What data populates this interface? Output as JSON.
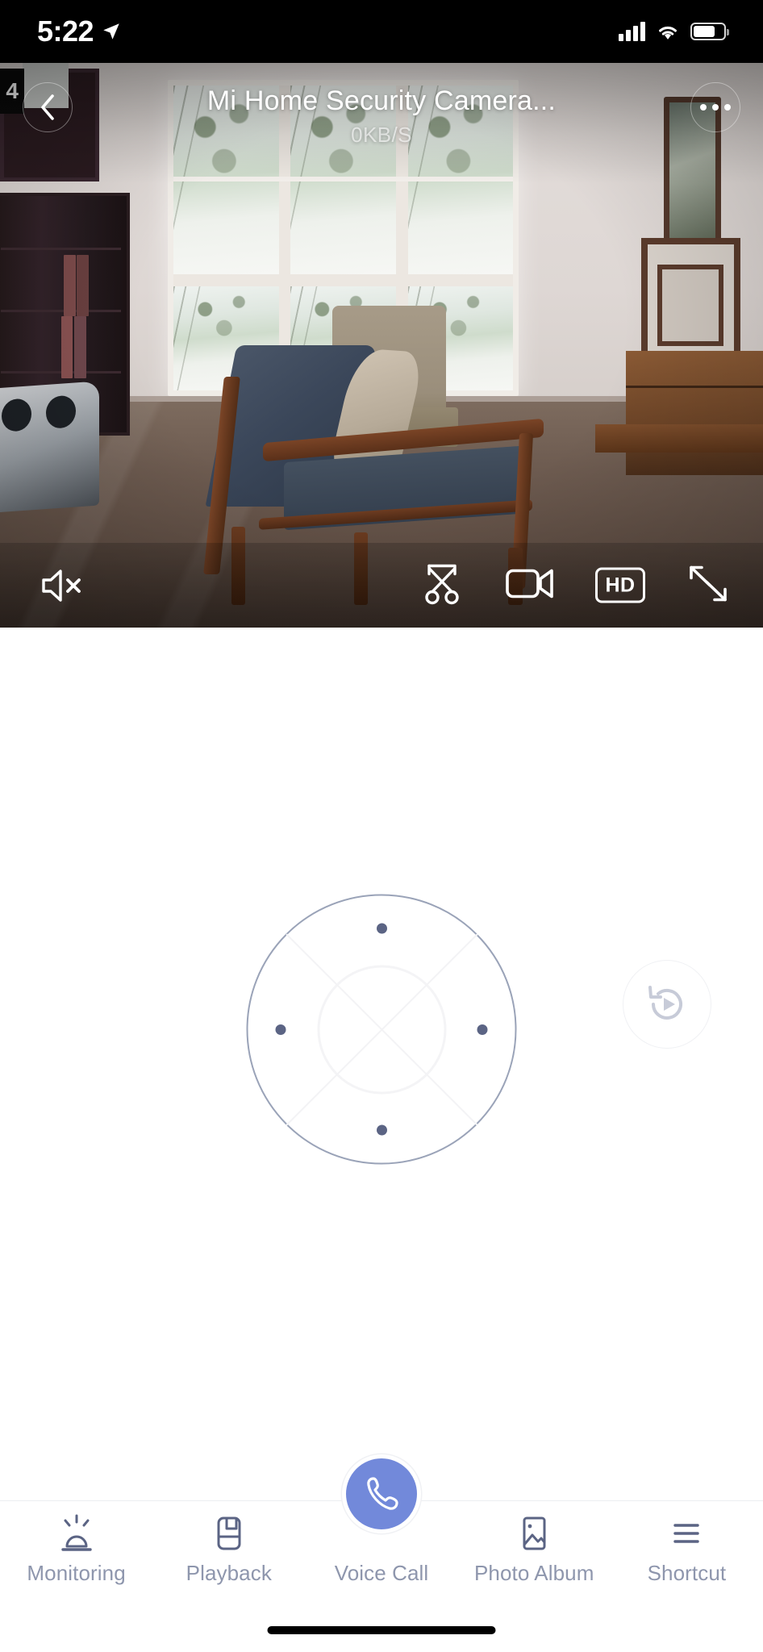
{
  "status_bar": {
    "time": "5:22",
    "location_icon": "location-arrow-icon",
    "cellular_icon": "cellular-signal-icon",
    "wifi_icon": "wifi-icon",
    "battery_icon": "battery-icon"
  },
  "video": {
    "title": "Mi Home Security Camera...",
    "bitrate": "0KB/S",
    "corner_badge": "4",
    "back_icon": "chevron-left-icon",
    "more_icon": "more-options-icon",
    "toolbar": {
      "mute": {
        "label": "",
        "icon": "speaker-mute-icon"
      },
      "snapshot": {
        "label": "",
        "icon": "scissors-snip-icon"
      },
      "record": {
        "label": "",
        "icon": "video-camera-icon"
      },
      "quality": {
        "label": "HD",
        "icon": "hd-quality-icon"
      },
      "fullscreen": {
        "label": "",
        "icon": "expand-fullscreen-icon"
      }
    }
  },
  "ptz": {
    "dpad_label": "direction-pad",
    "reset_icon": "rotate-reset-icon"
  },
  "tabbar": {
    "items": [
      {
        "label": "Monitoring",
        "icon": "alarm-siren-icon"
      },
      {
        "label": "Playback",
        "icon": "floppy-disk-icon"
      },
      {
        "label": "Voice Call",
        "icon": "phone-call-icon"
      },
      {
        "label": "Photo Album",
        "icon": "photo-image-icon"
      },
      {
        "label": "Shortcut",
        "icon": "hamburger-menu-icon"
      }
    ]
  },
  "colors": {
    "accent": "#7289da",
    "tab_text": "#8e96ad",
    "dpad_border": "#9aa3b8",
    "dpad_dot": "#5b6484"
  }
}
